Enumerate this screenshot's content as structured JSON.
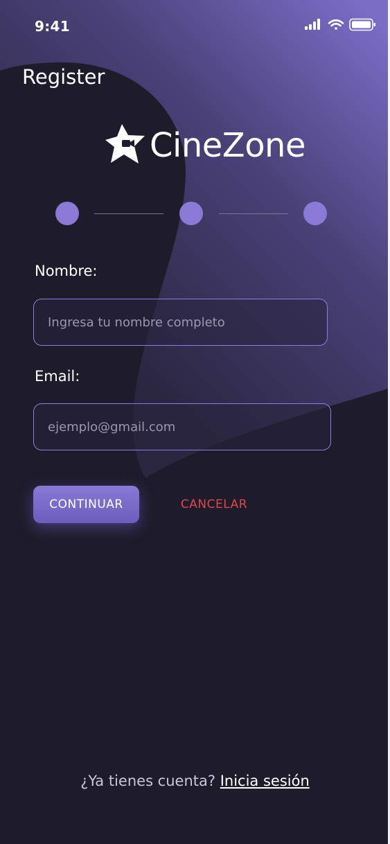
{
  "status_bar": {
    "time": "9:41"
  },
  "header": {
    "title": "Register"
  },
  "logo": {
    "text": "CineZone"
  },
  "stepper": {
    "total_steps": 3
  },
  "form": {
    "name_label": "Nombre:",
    "name_value": "",
    "name_placeholder": "Ingresa tu nombre completo",
    "email_label": "Email:",
    "email_value": "",
    "email_placeholder": "ejemplo@gmail.com"
  },
  "actions": {
    "continue_label": "CONTINUAR",
    "cancel_label": "CANCELAR"
  },
  "footer": {
    "prompt": "¿Ya tienes cuenta?",
    "login_link": "Inicia sesión"
  },
  "colors": {
    "background": "#1e1b2b",
    "accent": "#8a7ad6",
    "accent_dark": "#6c5cbd",
    "cancel": "#e0474d",
    "input_border": "#8d7fe0"
  },
  "icons": [
    "cellular-signal-icon",
    "wifi-icon",
    "battery-icon",
    "star-camera-logo-icon"
  ]
}
